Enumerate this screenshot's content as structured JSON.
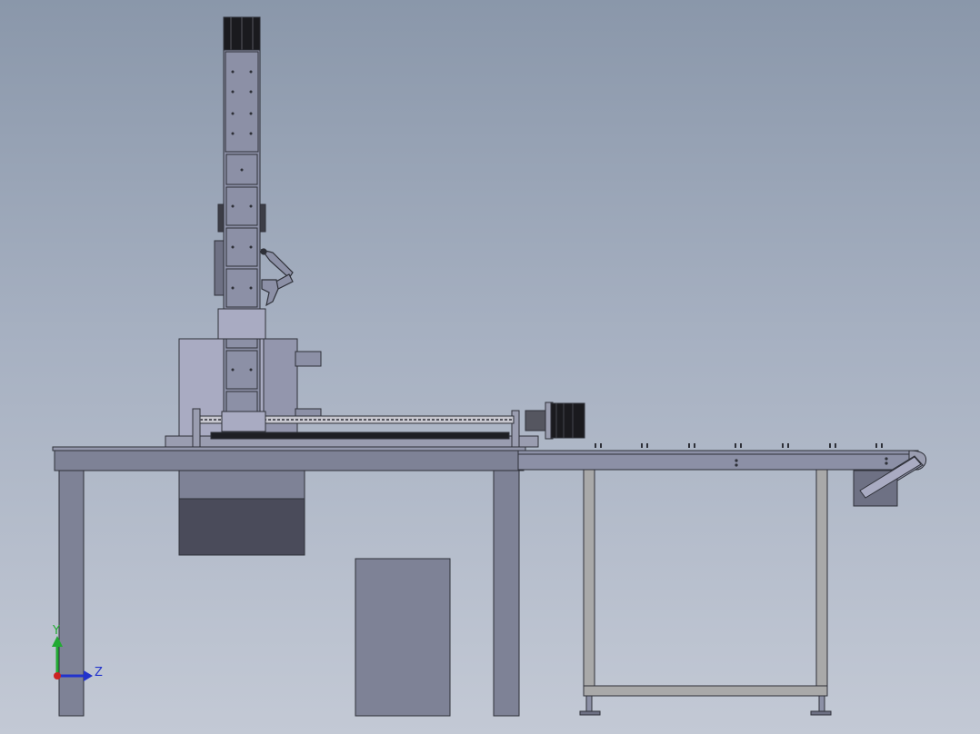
{
  "viewport": {
    "background_top": "#8a97aa",
    "background_bottom": "#c3c9d5"
  },
  "triad": {
    "y_label": "Y",
    "z_label": "Z",
    "y_color": "#22aa33",
    "z_color": "#2233cc",
    "x_color": "#cc2222"
  },
  "colors": {
    "frame": "#7e8296",
    "frame_dark": "#4a4b5a",
    "outline": "#2e3038",
    "column": "#8c90a6",
    "motor": "#1a1a1e",
    "conveyor_frame": "#a9a9a9",
    "cylinder": "#a9abc2"
  }
}
